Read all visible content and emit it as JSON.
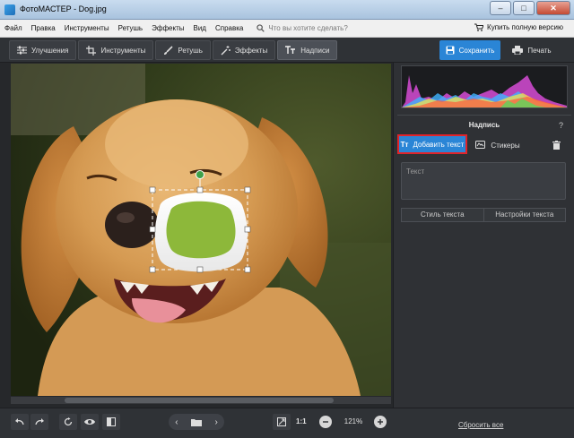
{
  "window": {
    "title": "ФотоМАСТЕР - Dog.jpg",
    "minimize": "–",
    "maximize": "□",
    "close": "✕"
  },
  "menu": {
    "items": [
      "Файл",
      "Правка",
      "Инструменты",
      "Ретушь",
      "Эффекты",
      "Вид",
      "Справка"
    ],
    "search_placeholder": "Что вы хотите сделать?",
    "buy_label": "Купить полную версию"
  },
  "toolbar": {
    "tabs": [
      {
        "label": "Улучшения",
        "icon": "sliders-icon"
      },
      {
        "label": "Инструменты",
        "icon": "crop-icon"
      },
      {
        "label": "Ретушь",
        "icon": "brush-icon"
      },
      {
        "label": "Эффекты",
        "icon": "magic-wand-icon"
      },
      {
        "label": "Надписи",
        "icon": "text-icon"
      }
    ],
    "active_tab": "Надписи",
    "save_label": "Сохранить",
    "print_label": "Печать"
  },
  "panel": {
    "title": "Надпись",
    "help": "?",
    "add_text_label": "Добавить текст",
    "add_text_icon": "Tт",
    "stickers_label": "Стикеры",
    "text_placeholder": "Текст",
    "sub_tabs": [
      "Стиль текста",
      "Настройки текста"
    ]
  },
  "bottom": {
    "ratio": "1:1",
    "zoom": "121%",
    "reset_label": "Сбросить все"
  },
  "colors": {
    "accent": "#2a85d6",
    "highlight_border": "#e0242a",
    "sticker_fill": "#8db83a",
    "handle_green": "#3fa14a"
  }
}
